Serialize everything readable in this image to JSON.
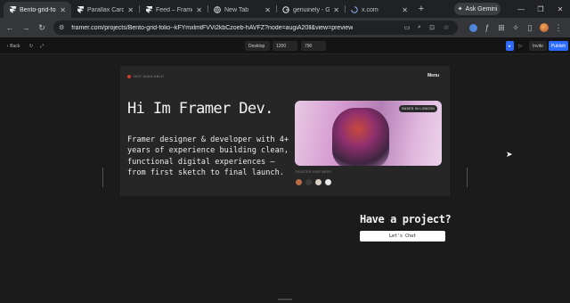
{
  "browser": {
    "tabs": [
      {
        "title": "Bento-grid-folio",
        "icon": "framer-icon",
        "active": true
      },
      {
        "title": "Parallax Card",
        "icon": "framer-icon",
        "active": false
      },
      {
        "title": "Feed – Framer",
        "icon": "framer-icon",
        "active": false
      },
      {
        "title": "New Tab",
        "icon": "globe-icon",
        "active": false
      },
      {
        "title": "genuinely - Go",
        "icon": "google-icon",
        "active": false
      },
      {
        "title": "x.com",
        "icon": "x-icon",
        "active": false
      }
    ],
    "new_tab_label": "+",
    "gemini_label": "Ask Gemini",
    "url": "framer.com/projects/Bento-grid-folio--kFYmxlmtFVVi2kbCzoeb-hAVFZ?node=augiA20ll&view=preview"
  },
  "framer_toolbar": {
    "back_label": "Back",
    "device": "Desktop",
    "width": "1200",
    "height": "790",
    "invite_label": "Invite",
    "publish_label": "Publish"
  },
  "site": {
    "status": "NOT AVAILABLE",
    "menu": "Menu",
    "hero_title": "Hi Im Framer Dev.",
    "bio": "Framer designer & developer with 4+ years of experience building clean, functional digital experiences — from first sketch to final launch.",
    "photo_badge": "BASED IN LONDON",
    "trusted_label": "TRUSTED PARTNERS",
    "project_heading": "Have a project?",
    "cta_label": "Let's Chat"
  },
  "colors": {
    "status_dot": "#d23a2f",
    "framer_publish": "#2d6bff"
  }
}
